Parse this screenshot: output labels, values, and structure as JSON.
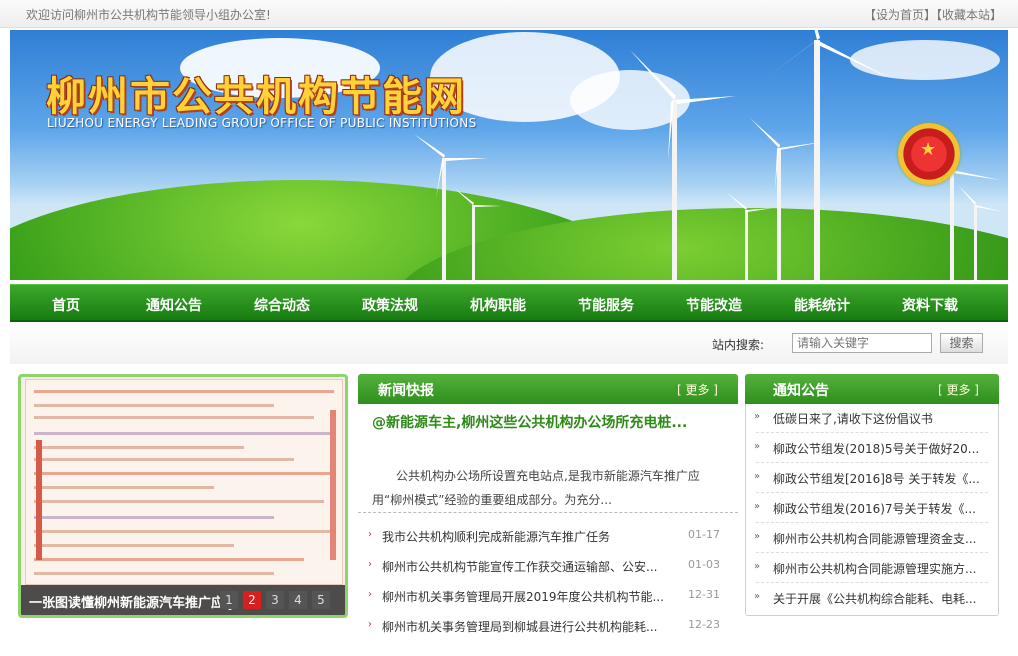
{
  "topbar": {
    "welcome": "欢迎访问柳州市公共机构节能领导小组办公室!",
    "set_home": "【设为首页】",
    "bookmark": "【收藏本站】"
  },
  "banner": {
    "title": "柳州市公共机构节能网",
    "subtitle": "LIUZHOU ENERGY LEADING GROUP OFFICE OF PUBLIC INSTITUTIONS"
  },
  "nav": {
    "items": [
      "首页",
      "通知公告",
      "综合动态",
      "政策法规",
      "机构职能",
      "节能服务",
      "节能改造",
      "能耗统计",
      "资料下载"
    ]
  },
  "search": {
    "label": "站内搜索:",
    "placeholder": "请输入关键字",
    "button": "搜索"
  },
  "slideshow": {
    "caption": "一张图读懂柳州新能源汽车推广",
    "caption_overlay": "应.jpg",
    "pages": [
      "1",
      "2",
      "3",
      "4",
      "5"
    ],
    "active_page": "2"
  },
  "news": {
    "title": "新闻快报",
    "more": "[ 更多 ]",
    "headline": "@新能源车主,柳州这些公共机构办公场所充电桩...",
    "summary": "公共机构办公场所设置充电站点,是我市新能源汽车推广应用“柳州模式”经验的重要组成部分。为充分...",
    "items": [
      {
        "title": "我市公共机构顺利完成新能源汽车推广任务",
        "date": "01-17"
      },
      {
        "title": "柳州市公共机构节能宣传工作获交通运输部、公安...",
        "date": "01-03"
      },
      {
        "title": "柳州市机关事务管理局开展2019年度公共机构节能...",
        "date": "12-31"
      },
      {
        "title": "柳州市机关事务管理局到柳城县进行公共机构能耗...",
        "date": "12-23"
      }
    ]
  },
  "notice": {
    "title": "通知公告",
    "more": "[ 更多 ]",
    "items": [
      "低碳日来了,请收下这份倡议书",
      "柳政公节组发(2018)5号关于做好20...",
      "柳政公节组发[2016]8号 关于转发《...",
      "柳政公节组发(2016)7号关于转发《...",
      "柳州市公共机构合同能源管理资金支...",
      "柳州市公共机构合同能源管理实施方...",
      "关于开展《公共机构综合能耗、电耗..."
    ]
  },
  "colors": {
    "nav_green": "#177c10",
    "accent_green": "#2e8a18",
    "active_page_red": "#d81e1e",
    "title_gold": "#ffd23a"
  },
  "icons": {
    "list_bullet": "arrow-bullet-icon",
    "emblem": "national-emblem-icon"
  }
}
